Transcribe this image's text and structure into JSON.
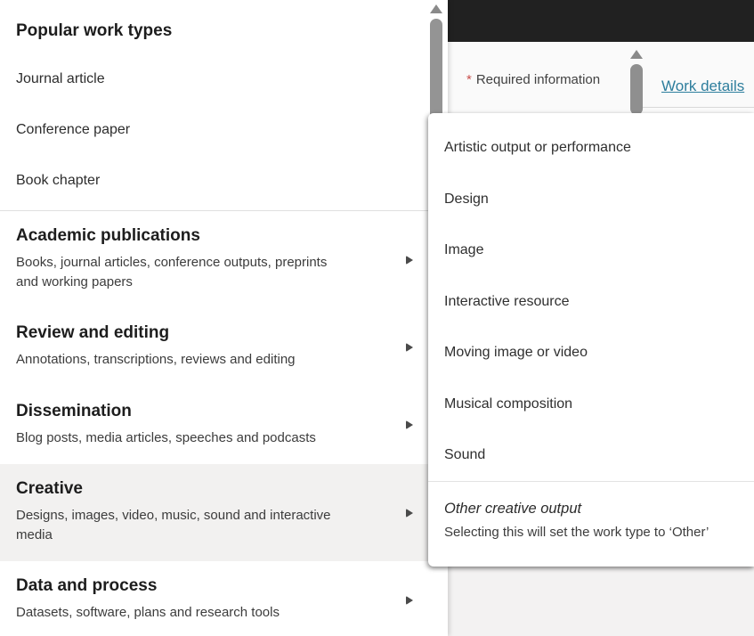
{
  "page": {
    "required_note": {
      "asterisk": "*",
      "text": "Required information"
    },
    "work_details_link": "Work details"
  },
  "menu": {
    "popular_header": "Popular work types",
    "popular_items": [
      "Journal article",
      "Conference paper",
      "Book chapter"
    ],
    "sections": [
      {
        "title": "Academic publications",
        "desc": "Books, journal articles, conference outputs, preprints\nand working papers",
        "highlighted": false
      },
      {
        "title": "Review and editing",
        "desc": "Annotations, transcriptions, reviews and editing",
        "highlighted": false
      },
      {
        "title": "Dissemination",
        "desc": "Blog posts, media articles, speeches and podcasts",
        "highlighted": false
      },
      {
        "title": "Creative",
        "desc": "Designs, images, video, music, sound and interactive\nmedia",
        "highlighted": true
      },
      {
        "title": "Data and process",
        "desc": "Datasets, software, plans and research tools",
        "highlighted": false
      }
    ]
  },
  "submenu": {
    "items": [
      "Artistic output or performance",
      "Design",
      "Image",
      "Interactive resource",
      "Moving image or video",
      "Musical composition",
      "Sound"
    ],
    "other": {
      "title": "Other creative output",
      "note": "Selecting this will set the work type to ‘Other’"
    }
  },
  "colors": {
    "accent_link": "#2e7e9d",
    "required_red": "#c9504e",
    "header_dark": "#212121",
    "highlight_gray": "#f2f1f0"
  }
}
